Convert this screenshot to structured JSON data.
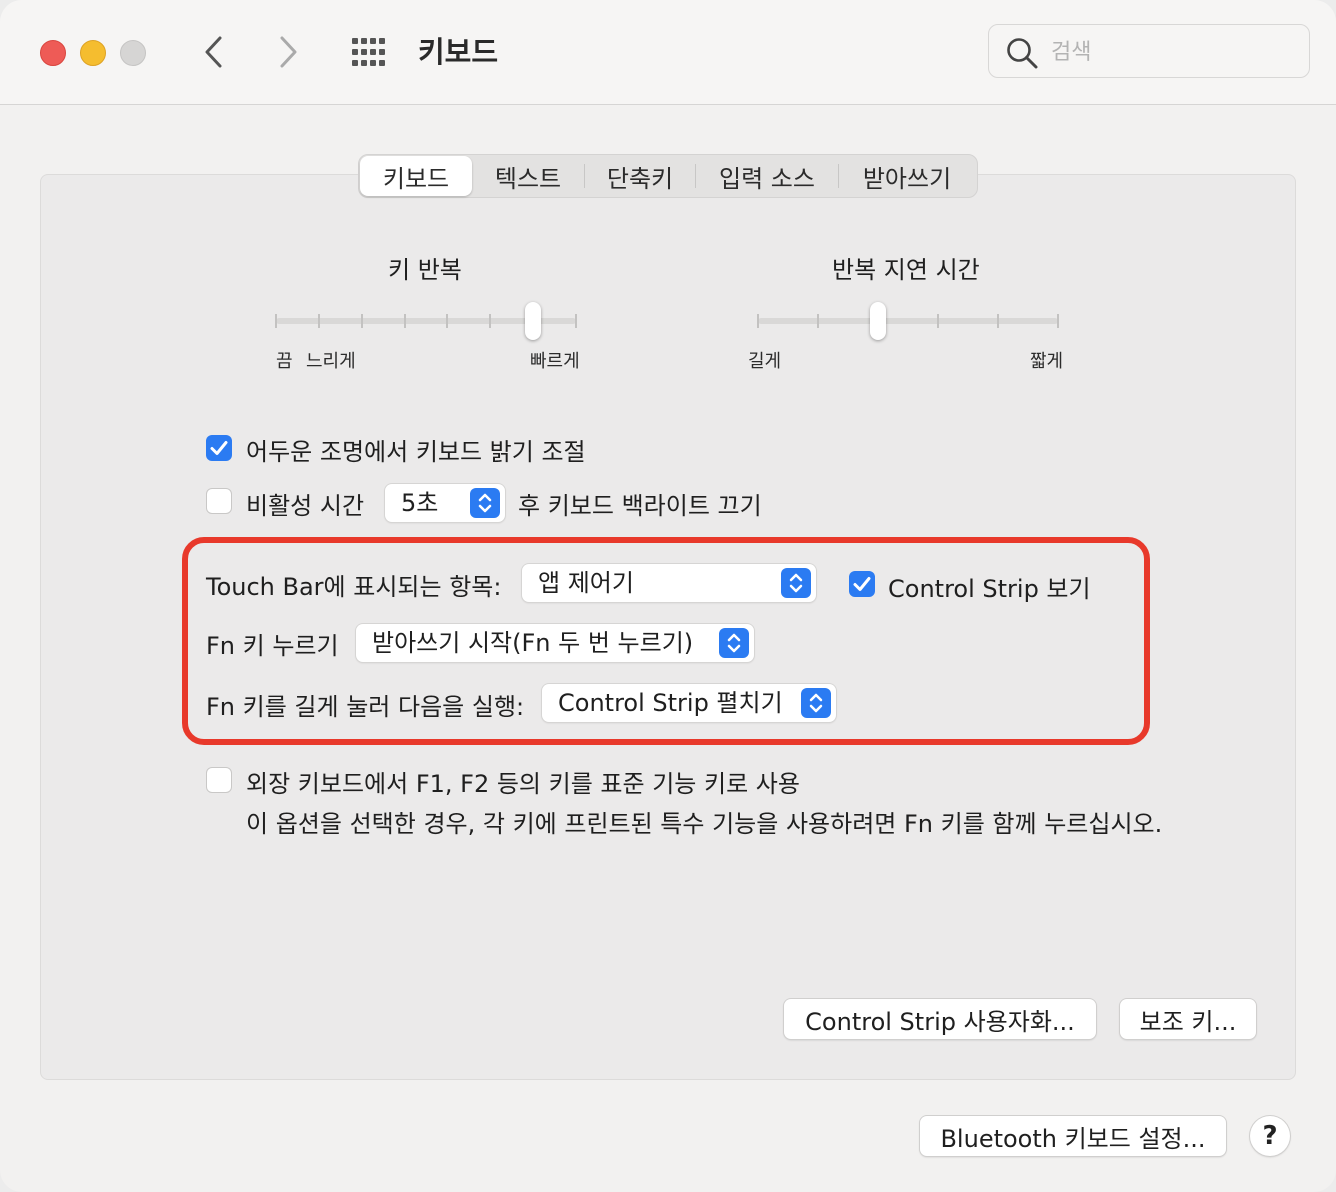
{
  "window": {
    "title": "키보드"
  },
  "search": {
    "placeholder": "검색",
    "value": ""
  },
  "tabs": [
    {
      "label": "키보드",
      "active": true
    },
    {
      "label": "텍스트",
      "active": false
    },
    {
      "label": "단축키",
      "active": false
    },
    {
      "label": "입력 소스",
      "active": false
    },
    {
      "label": "받아쓰기",
      "active": false
    }
  ],
  "key_repeat": {
    "title": "키 반복",
    "min_label": "끔",
    "slow_label": "느리게",
    "fast_label": "빠르게",
    "ticks": 8,
    "position": 6
  },
  "repeat_delay": {
    "title": "반복 지연 시간",
    "long_label": "길게",
    "short_label": "짧게",
    "ticks": 6,
    "position": 2
  },
  "options": {
    "adjust_brightness": {
      "label": "어두운 조명에서 키보드 밝기 조절",
      "checked": true
    },
    "backlight_off": {
      "label_prefix": "비활성 시간",
      "value": "5초",
      "label_suffix": "후 키보드 백라이트 끄기",
      "checked": false
    }
  },
  "touchbar": {
    "shows_label": "Touch Bar에 표시되는 항목:",
    "shows_value": "앱 제어기",
    "control_strip_label": "Control Strip 보기",
    "control_strip_checked": true,
    "fn_press_label": "Fn 키 누르기",
    "fn_press_value": "받아쓰기 시작(Fn 두 번 누르기)",
    "fn_hold_label": "Fn 키를 길게 눌러 다음을 실행:",
    "fn_hold_value": "Control Strip 펼치기"
  },
  "function_keys": {
    "label": "외장 키보드에서 F1, F2 등의 키를 표준 기능 키로 사용",
    "description": "이 옵션을 선택한 경우, 각 키에 프린트된 특수 기능을 사용하려면 Fn 키를 함께 누르십시오.",
    "checked": false
  },
  "buttons": {
    "customize_control_strip": "Control Strip 사용자화...",
    "modifier_keys": "보조 키...",
    "bluetooth_setup": "Bluetooth 키보드 설정...",
    "help": "?"
  },
  "colors": {
    "accent": "#2b7bf2",
    "highlight": "#e8392b",
    "close": "#ee5b56",
    "minimize": "#f5bd2f",
    "zoom": "#d6d5d4"
  }
}
